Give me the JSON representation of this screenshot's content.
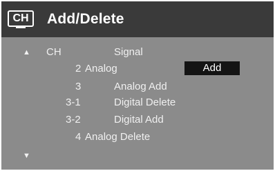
{
  "header": {
    "icon_label": "CH",
    "title": "Add/Delete"
  },
  "columns": {
    "ch": "CH",
    "signal": "Signal"
  },
  "rows": [
    {
      "channel": "2",
      "signal": "Analog"
    },
    {
      "channel": "3",
      "signal": "Analog Add"
    },
    {
      "channel": "3-1",
      "signal": "Digital Delete"
    },
    {
      "channel": "3-2",
      "signal": "Digital Add"
    },
    {
      "channel": "4",
      "signal": "Analog Delete"
    }
  ],
  "selected_action": "Add",
  "icons": {
    "scroll_up": "up-triangle",
    "scroll_down": "down-triangle"
  },
  "colors": {
    "header_bg": "#3a3a3a",
    "content_bg": "#8b8b8b",
    "highlight_bg": "#141414",
    "text": "#f0f0f0"
  }
}
